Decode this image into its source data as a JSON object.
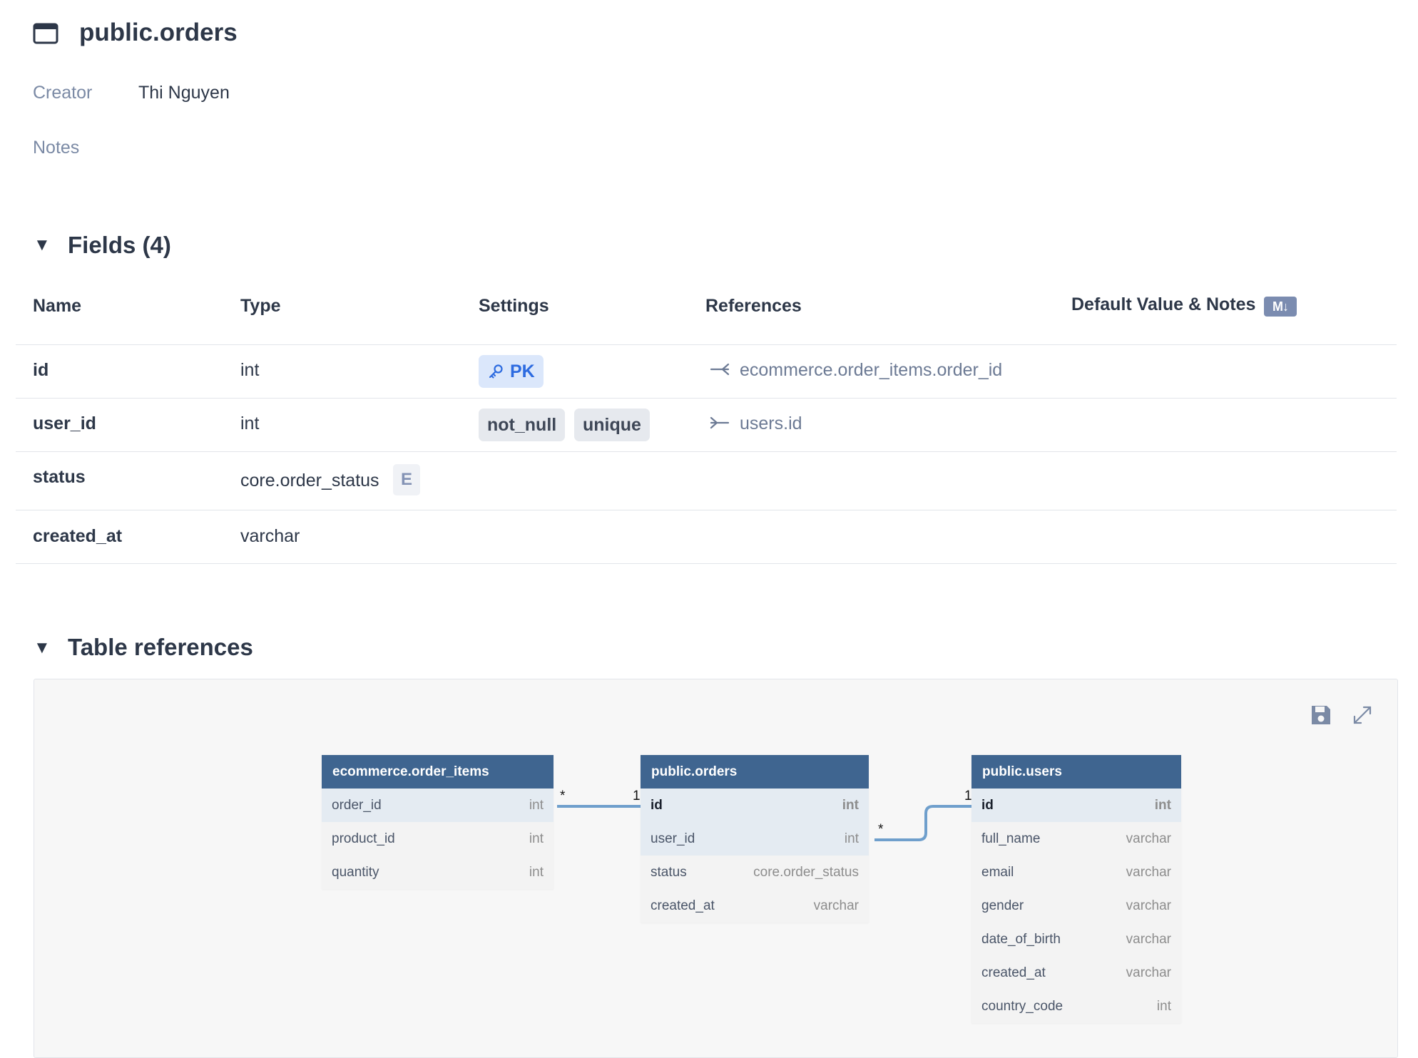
{
  "header": {
    "title": "public.orders",
    "creator_label": "Creator",
    "creator_value": "Thi Nguyen",
    "notes_label": "Notes"
  },
  "fields_section": {
    "title": "Fields (4)",
    "columns": {
      "name": "Name",
      "type": "Type",
      "settings": "Settings",
      "references": "References",
      "default_notes": "Default Value & Notes"
    },
    "md_badge": "M↓",
    "rows": [
      {
        "name": "id",
        "type": "int",
        "settings": [
          "PK"
        ],
        "reference": "ecommerce.order_items.order_id"
      },
      {
        "name": "user_id",
        "type": "int",
        "settings": [
          "not_null",
          "unique"
        ],
        "reference": "users.id"
      },
      {
        "name": "status",
        "type": "core.order_status",
        "type_badge": "E"
      },
      {
        "name": "created_at",
        "type": "varchar"
      }
    ]
  },
  "refs_section": {
    "title": "Table references"
  },
  "diagram": {
    "tables": [
      {
        "name": "ecommerce.order_items",
        "fields": [
          {
            "name": "order_id",
            "type": "int"
          },
          {
            "name": "product_id",
            "type": "int"
          },
          {
            "name": "quantity",
            "type": "int"
          }
        ]
      },
      {
        "name": "public.orders",
        "fields": [
          {
            "name": "id",
            "type": "int"
          },
          {
            "name": "user_id",
            "type": "int"
          },
          {
            "name": "status",
            "type": "core.order_status"
          },
          {
            "name": "created_at",
            "type": "varchar"
          }
        ]
      },
      {
        "name": "public.users",
        "fields": [
          {
            "name": "id",
            "type": "int"
          },
          {
            "name": "full_name",
            "type": "varchar"
          },
          {
            "name": "email",
            "type": "varchar"
          },
          {
            "name": "gender",
            "type": "varchar"
          },
          {
            "name": "date_of_birth",
            "type": "varchar"
          },
          {
            "name": "created_at",
            "type": "varchar"
          },
          {
            "name": "country_code",
            "type": "int"
          }
        ]
      }
    ],
    "relations": [
      {
        "from_card": "*",
        "to_card": "1"
      },
      {
        "from_card": "*",
        "to_card": "1"
      }
    ],
    "toolbar": {
      "save_icon": "save-icon",
      "expand_icon": "expand-icon"
    }
  },
  "colors": {
    "table_header": "#3f6590",
    "highlight_row": "#e4ebf2",
    "connector": "#6f9fcc",
    "pk_chip_bg": "#dbe7fb",
    "pk_chip_text": "#2d6be0"
  }
}
